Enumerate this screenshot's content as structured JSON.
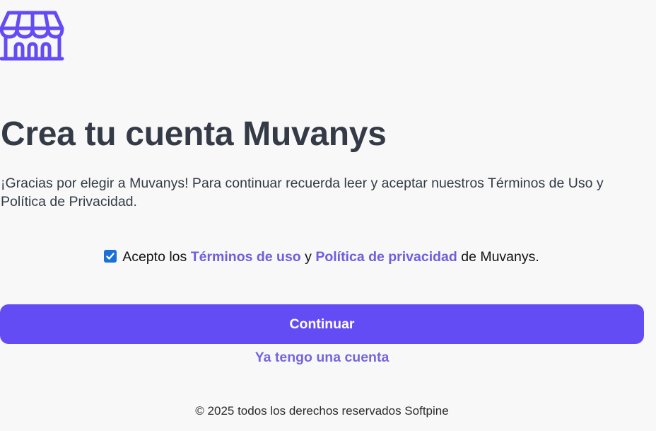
{
  "logo": {
    "icon": "storefront-icon",
    "color": "#634cf4"
  },
  "heading": {
    "title": "Crea tu cuenta Muvanys"
  },
  "intro": {
    "text": "¡Gracias por elegir a Muvanys! Para continuar recuerda leer y aceptar nuestros Términos de Uso y Política de Privacidad."
  },
  "terms": {
    "checked": true,
    "prefix": "Acepto los",
    "terms_link": "Términos de uso",
    "conjunction": "y",
    "privacy_link": "Política de privacidad",
    "suffix": "de Muvanys."
  },
  "actions": {
    "continue_label": "Continuar",
    "have_account_label": "Ya tengo una cuenta"
  },
  "footer": {
    "text": "© 2025 todos los derechos reservados Softpine"
  },
  "colors": {
    "accent": "#634cf4",
    "link": "#6d5ee0",
    "checkbox": "#1a6fd9",
    "background": "#f8f8f8"
  }
}
